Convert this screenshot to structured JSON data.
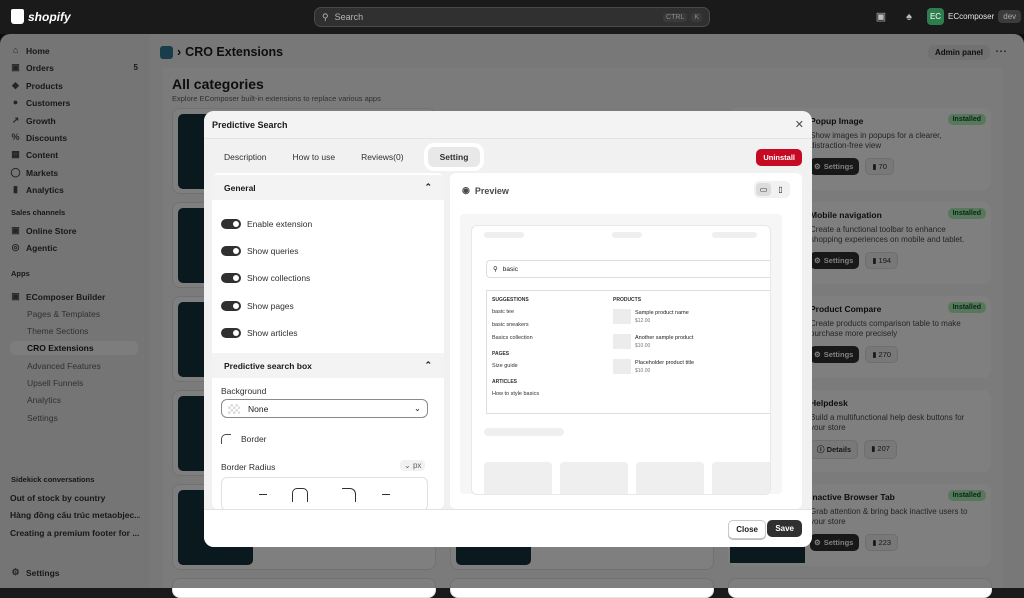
{
  "topbar": {
    "brand": "shopify",
    "search_placeholder": "Search",
    "shortcut_1": "CTRL",
    "shortcut_2": "K",
    "store_name": "ECcomposer",
    "store_badge": "dev",
    "store_initials": "EC"
  },
  "sidebar": {
    "items": [
      {
        "label": "Home"
      },
      {
        "label": "Orders",
        "count": "5"
      },
      {
        "label": "Products"
      },
      {
        "label": "Customers"
      },
      {
        "label": "Growth"
      },
      {
        "label": "Discounts"
      },
      {
        "label": "Content"
      },
      {
        "label": "Markets"
      },
      {
        "label": "Analytics"
      }
    ],
    "sales_channels": "Sales channels",
    "channels": [
      {
        "label": "Online Store"
      },
      {
        "label": "Agentic"
      }
    ],
    "apps": "Apps",
    "app_name": "EComposer Builder",
    "app_sub": [
      "Pages & Templates",
      "Theme Sections",
      "CRO Extensions",
      "Advanced Features",
      "Upsell Funnels",
      "Analytics",
      "Settings"
    ],
    "sidekick": "Sidekick conversations",
    "conversations": [
      "Out of stock by country",
      "Hàng đồng cấu trúc metaobjec...",
      "Creating a premium footer for ..."
    ],
    "settings": "Settings"
  },
  "page": {
    "title": "CRO Extensions",
    "admin_panel": "Admin panel",
    "heading": "All categories",
    "subheading": "Explore EComposer built-in extensions to replace various apps"
  },
  "right_cards": [
    {
      "title": "Popup Image",
      "badge": "Installed",
      "desc": "Show images in popups for a clearer, distraction-free view",
      "btn": "Settings",
      "count": "70"
    },
    {
      "title": "Mobile navigation",
      "badge": "Installed",
      "desc": "Create a functional toolbar to enhance shopping experiences on mobile and tablet.",
      "btn": "Settings",
      "count": "194"
    },
    {
      "title": "Product Compare",
      "badge": "Installed",
      "desc": "Create products comparison table to make purchase more precisely",
      "btn": "Settings",
      "count": "270"
    },
    {
      "title": "Helpdesk",
      "badge": "",
      "desc": "Build a multifunctional help desk buttons for your store",
      "btn": "Details",
      "count": "207"
    },
    {
      "title": "Inactive Browser Tab",
      "badge": "Installed",
      "desc": "Grab attention & bring back inactive users to your store",
      "btn": "Settings",
      "count": "223"
    }
  ],
  "modal": {
    "title": "Predictive Search",
    "tabs": [
      "Description",
      "How to use",
      "Reviews(0)",
      "Setting"
    ],
    "uninstall": "Uninstall",
    "general": "General",
    "toggles": [
      "Enable extension",
      "Show queries",
      "Show collections",
      "Show pages",
      "Show articles"
    ],
    "box_section": "Predictive search box",
    "background_label": "Background",
    "background_value": "None",
    "border_label": "Border",
    "radius_label": "Border Radius",
    "radius_unit": "px",
    "preview_label": "Preview",
    "close": "Close",
    "save": "Save"
  },
  "preview": {
    "query": "basic",
    "suggestions_head": "SUGGESTIONS",
    "suggestions": [
      "basic tee",
      "basic sneakers",
      "Basics collection"
    ],
    "pages_head": "PAGES",
    "pages": [
      "Size guide"
    ],
    "articles_head": "ARTICLES",
    "articles": [
      "How to style basics"
    ],
    "products_head": "PRODUCTS",
    "products": [
      {
        "name": "Sample product name",
        "price": "$12.00"
      },
      {
        "name": "Another sample product",
        "price": "$10.00"
      },
      {
        "name": "Placeholder product title",
        "price": "$10.00"
      }
    ]
  }
}
